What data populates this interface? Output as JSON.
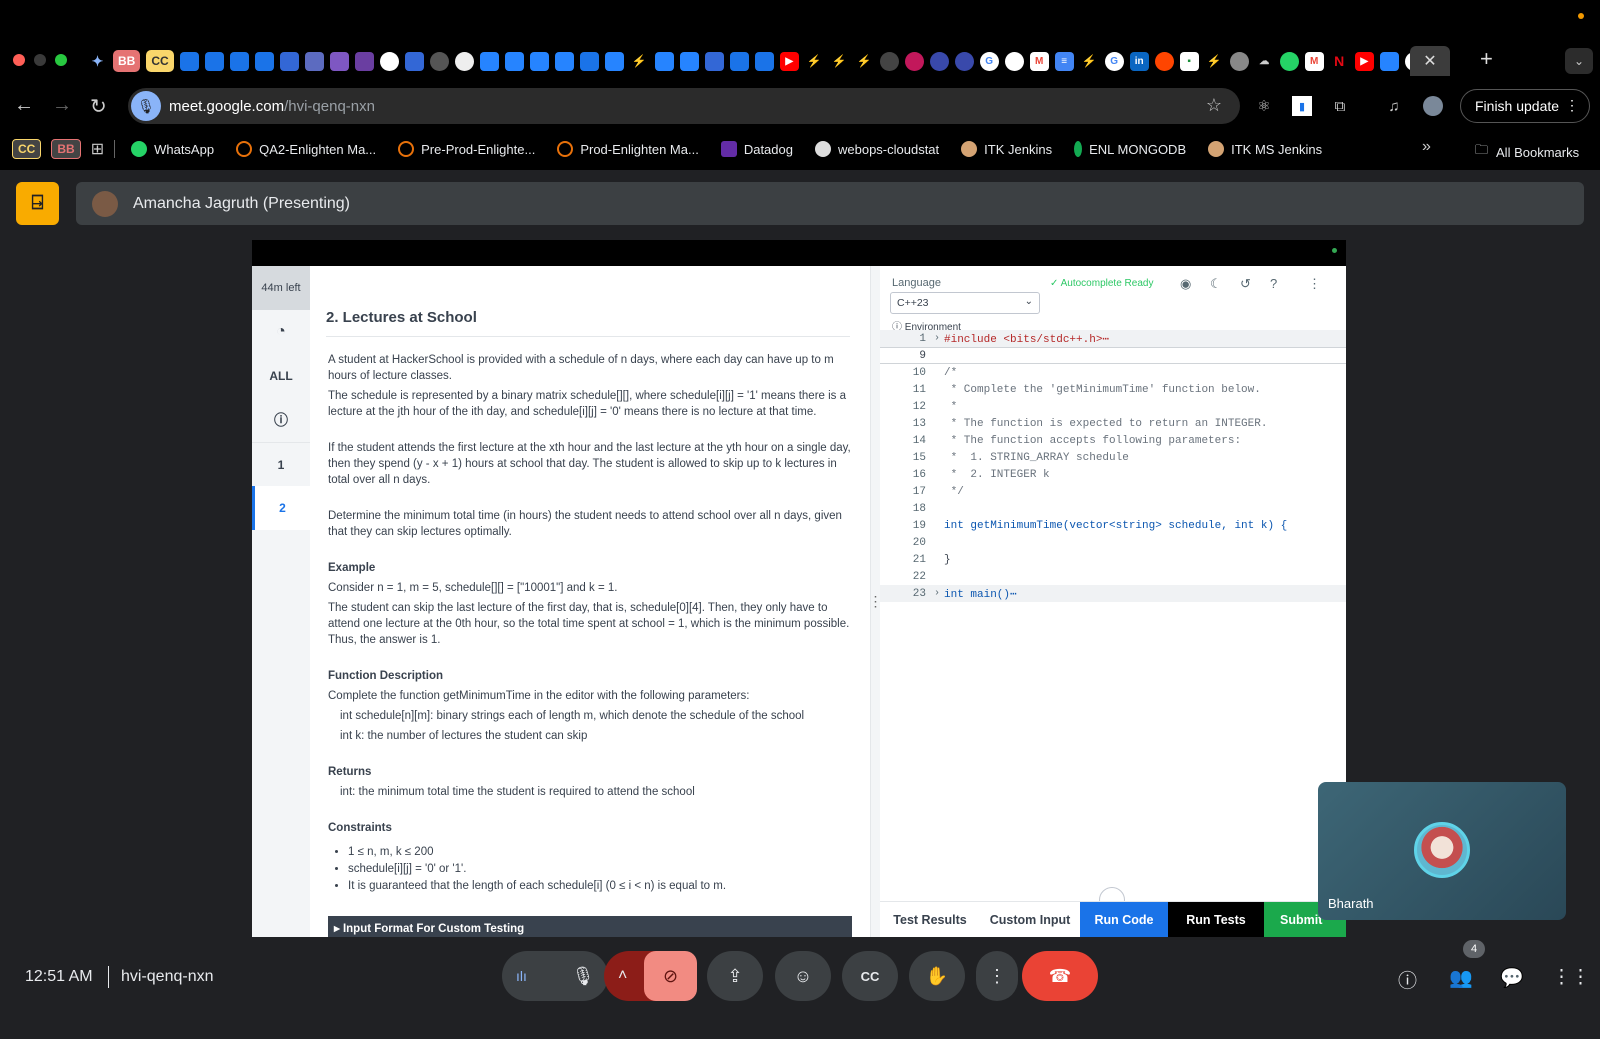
{
  "browser": {
    "tab_pills": [
      "BB",
      "CC"
    ],
    "url_host": "meet.google.com",
    "url_path": "/hvi-qenq-nxn",
    "finish_update_label": "Finish update",
    "bookmarks": [
      "WhatsApp",
      "QA2-Enlighten Ma...",
      "Pre-Prod-Enlighte...",
      "Prod-Enlighten Ma...",
      "Datadog",
      "webops-cloudstat",
      "ITK Jenkins",
      "ENL MONGODB",
      "ITK MS Jenkins"
    ],
    "bookmark_pills": [
      "CC",
      "BB"
    ],
    "all_bookmarks_label": "All Bookmarks"
  },
  "meet": {
    "presenter_label": "Amancha Jagruth (Presenting)",
    "self_tile_name": "Bharath",
    "clock": "12:51 AM",
    "meeting_code": "hvi-qenq-nxn",
    "participants_count": "4"
  },
  "hackerrank": {
    "timer": "44m left",
    "nav": [
      "ALL",
      "1",
      "2"
    ],
    "problem_title": "2. Lectures at School",
    "statement_1": "A student at HackerSchool is provided with a schedule of n days, where each day can have up to m hours of lecture classes.",
    "statement_2": "The schedule is represented by a binary matrix schedule[][], where schedule[i][j] = '1' means there is a lecture at the jth hour of the ith day, and schedule[i][j] = '0' means there is no lecture at that time.",
    "statement_3": "If the student attends the first lecture at the xth hour and the last lecture at the yth hour on a single day, then they spend (y - x + 1) hours at school that day. The student is allowed to skip up to k lectures in total over all n days.",
    "statement_4": "Determine the minimum total time (in hours) the student needs to attend school over all n days, given that they can skip lectures optimally.",
    "example_heading": "Example",
    "example_1": "Consider n = 1, m = 5, schedule[][] = [\"10001\"] and k = 1.",
    "example_2": "The student can skip the last lecture of the first day, that is, schedule[0][4]. Then, they only have to attend one lecture at the 0th hour, so the total time spent at school = 1, which is the minimum possible. Thus, the answer is 1.",
    "function_heading": "Function Description",
    "function_desc": "Complete the function getMinimumTime in the editor with the following parameters:",
    "param_1": "int schedule[n][m]: binary strings each of length m, which denote the schedule of the school",
    "param_2": "int k: the number of lectures the student can skip",
    "returns_heading": "Returns",
    "returns_text": "int: the minimum total time the student is required to attend the school",
    "constraints_heading": "Constraints",
    "constraints": [
      "1 ≤ n, m, k ≤ 200",
      "schedule[i][j] = '0' or '1'.",
      "It is guaranteed that the length of each schedule[i] (0 ≤ i < n) is equal to m."
    ],
    "input_format_label": "▸ Input Format For Custom Testing",
    "language_label": "Language",
    "language_value": "C++23",
    "environment_label": "Environment",
    "autocomplete_label": "Autocomplete Ready",
    "code_lines": [
      {
        "n": "1",
        "t": "#include <bits/stdc++.h>⋯"
      },
      {
        "n": "9",
        "t": ""
      },
      {
        "n": "10",
        "t": "/*"
      },
      {
        "n": "11",
        "t": " * Complete the 'getMinimumTime' function below."
      },
      {
        "n": "12",
        "t": " *"
      },
      {
        "n": "13",
        "t": " * The function is expected to return an INTEGER."
      },
      {
        "n": "14",
        "t": " * The function accepts following parameters:"
      },
      {
        "n": "15",
        "t": " *  1. STRING_ARRAY schedule"
      },
      {
        "n": "16",
        "t": " *  2. INTEGER k"
      },
      {
        "n": "17",
        "t": " */"
      },
      {
        "n": "18",
        "t": ""
      },
      {
        "n": "19",
        "t": "int getMinimumTime(vector<string> schedule, int k) {"
      },
      {
        "n": "20",
        "t": ""
      },
      {
        "n": "21",
        "t": "}"
      },
      {
        "n": "22",
        "t": ""
      },
      {
        "n": "23",
        "t": "int main()⋯"
      }
    ],
    "bottom_buttons": {
      "test_results": "Test Results",
      "custom_input": "Custom Input",
      "run_code": "Run Code",
      "run_tests": "Run Tests",
      "submit": "Submit"
    }
  },
  "colors": {
    "hr_green": "#2ec866",
    "hr_blue": "#1ba94c",
    "run_code_blue": "#1a73e8",
    "meet_red": "#ea4335",
    "present_yellow": "#f9ab00"
  }
}
